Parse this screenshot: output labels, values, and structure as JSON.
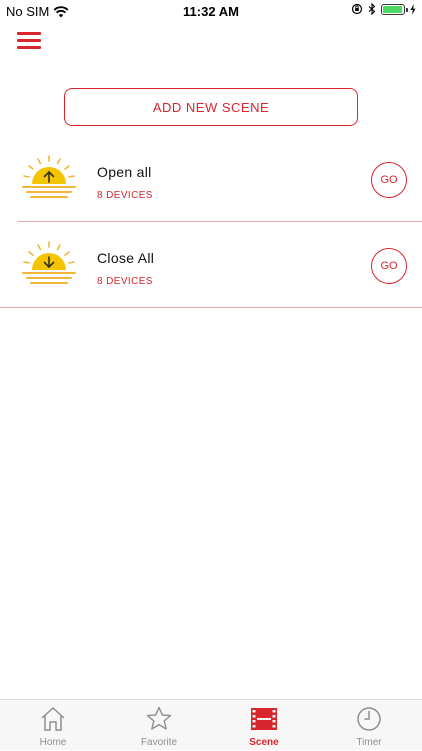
{
  "status_bar": {
    "carrier": "No SIM",
    "time": "11:32 AM",
    "battery_level": 0.95
  },
  "header": {
    "menu_icon": "hamburger-menu-icon"
  },
  "actions": {
    "add_scene_label": "ADD NEW SCENE"
  },
  "scenes": [
    {
      "name": "Open all",
      "devices": "8 DEVICES",
      "go_label": "GO",
      "icon": "sunrise-arrow-up-icon"
    },
    {
      "name": "Close All",
      "devices": "8 DEVICES",
      "go_label": "GO",
      "icon": "sunset-arrow-down-icon"
    }
  ],
  "tabs": [
    {
      "label": "Home",
      "icon": "home-icon",
      "active": false
    },
    {
      "label": "Favorite",
      "icon": "star-icon",
      "active": false
    },
    {
      "label": "Scene",
      "icon": "film-strip-icon",
      "active": true
    },
    {
      "label": "Timer",
      "icon": "clock-icon",
      "active": false
    }
  ],
  "colors": {
    "accent": "#d9262c",
    "sun": "#f5c400",
    "sun_rays": "#f2b53a",
    "tab_inactive": "#8e8e8e"
  }
}
